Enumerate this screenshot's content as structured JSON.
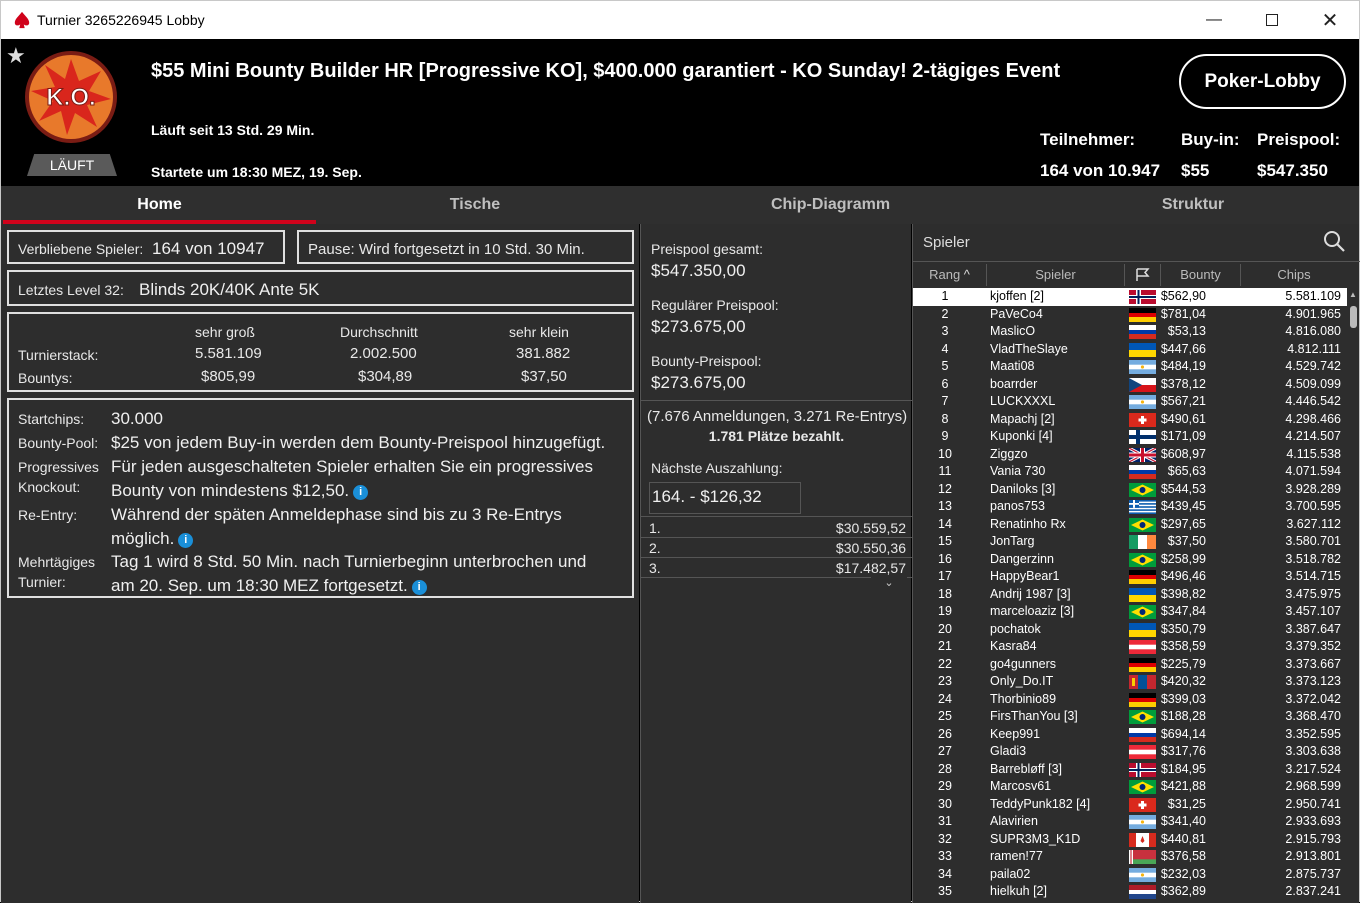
{
  "window": {
    "title": "Turnier 3265226945 Lobby"
  },
  "header": {
    "title": "$55 Mini Bounty Builder HR [Progressive KO], $400.000 garantiert - KO Sunday! 2-tägiges Event",
    "running": "Läuft seit 13 Std. 29 Min.",
    "started": "Startete um 18:30 MEZ, 19. Sep.",
    "status_badge": "LÄUFT",
    "logo_text": "K.O.",
    "lobby_button": "Poker-Lobby",
    "participants_label": "Teilnehmer:",
    "participants_value": "164 von 10.947",
    "buyin_label": "Buy-in:",
    "buyin_value": "$55",
    "prizepool_label": "Preispool:",
    "prizepool_value": "$547.350"
  },
  "tabs": [
    {
      "label": "Home",
      "active": true
    },
    {
      "label": "Tische"
    },
    {
      "label": "Chip-Diagramm"
    },
    {
      "label": "Struktur"
    }
  ],
  "home": {
    "remaining_label": "Verbliebene Spieler:",
    "remaining_value": "164 von 10947",
    "pause": "Pause: Wird fortgesetzt in 10 Std. 30 Min.",
    "level_label": "Letztes Level 32:",
    "level_value": "Blinds 20K/40K Ante 5K",
    "stats": {
      "cols": [
        "sehr groß",
        "Durchschnitt",
        "sehr klein"
      ],
      "stack_label": "Turnierstack:",
      "stack": [
        "5.581.109",
        "2.002.500",
        "381.882"
      ],
      "bounty_label": "Bountys:",
      "bounty": [
        "$805,99",
        "$304,89",
        "$37,50"
      ]
    },
    "info": {
      "startchips_label": "Startchips:",
      "startchips_value": "30.000",
      "bountypool_label": "Bounty-Pool:",
      "bountypool_value": "$25 von jedem Buy-in werden dem Bounty-Preispool hinzugefügt.",
      "pko_label1": "Progressives",
      "pko_label2": "Knockout:",
      "pko_value1": "Für jeden ausgeschalteten Spieler erhalten Sie ein progressives",
      "pko_value2": "Bounty von mindestens $12,50.",
      "reentry_label": "Re-Entry:",
      "reentry_value1": "Während der späten Anmeldephase sind bis zu 3 Re-Entrys",
      "reentry_value2": "möglich.",
      "multiday_label1": "Mehrtägiges",
      "multiday_label2": "Turnier:",
      "multiday_value1": "Tag 1 wird 8 Std. 50 Min. nach Turnierbeginn unterbrochen und",
      "multiday_value2": "am 20. Sep. um 18:30 MEZ fortgesetzt.",
      "info_glyph": "i"
    }
  },
  "prizes": {
    "total_label": "Preispool gesamt:",
    "total_value": "$547.350,00",
    "regular_label": "Regulärer Preispool:",
    "regular_value": "$273.675,00",
    "bounty_label": "Bounty-Preispool:",
    "bounty_value": "$273.675,00",
    "entries": "(7.676 Anmeldungen, 3.271 Re-Entrys)",
    "paid": "1.781 Plätze bezahlt.",
    "next_label": "Nächste Auszahlung:",
    "next_value": "164. - $126,32",
    "payouts": [
      {
        "place": "1.",
        "amount": "$30.559,52"
      },
      {
        "place": "2.",
        "amount": "$30.550,36"
      },
      {
        "place": "3.",
        "amount": "$17.482,57"
      }
    ]
  },
  "players": {
    "title": "Spieler",
    "columns": {
      "rank": "Rang",
      "player": "Spieler",
      "bounty": "Bounty",
      "chips": "Chips"
    },
    "rows": [
      {
        "rank": "1",
        "name": "kjoffen [2]",
        "flag": "NO",
        "bounty": "$562,90",
        "chips": "5.581.109"
      },
      {
        "rank": "2",
        "name": "PaVeCo4",
        "flag": "DE",
        "bounty": "$781,04",
        "chips": "4.901.965"
      },
      {
        "rank": "3",
        "name": "MaslicO",
        "flag": "RU",
        "bounty": "$53,13",
        "chips": "4.816.080"
      },
      {
        "rank": "4",
        "name": "VladTheSlaye",
        "flag": "UA",
        "bounty": "$447,66",
        "chips": "4.812.111"
      },
      {
        "rank": "5",
        "name": "Maati08",
        "flag": "AR",
        "bounty": "$484,19",
        "chips": "4.529.742"
      },
      {
        "rank": "6",
        "name": "boarrder",
        "flag": "CZ",
        "bounty": "$378,12",
        "chips": "4.509.099"
      },
      {
        "rank": "7",
        "name": "LUCKXXXL",
        "flag": "AR",
        "bounty": "$567,21",
        "chips": "4.446.542"
      },
      {
        "rank": "8",
        "name": "Mapachj [2]",
        "flag": "CH",
        "bounty": "$490,61",
        "chips": "4.298.466"
      },
      {
        "rank": "9",
        "name": "Kuponki [4]",
        "flag": "FI",
        "bounty": "$171,09",
        "chips": "4.214.507"
      },
      {
        "rank": "10",
        "name": "Ziggzo",
        "flag": "GB",
        "bounty": "$608,97",
        "chips": "4.115.538"
      },
      {
        "rank": "11",
        "name": "Vania 730",
        "flag": "RU",
        "bounty": "$65,63",
        "chips": "4.071.594"
      },
      {
        "rank": "12",
        "name": "Daniloks [3]",
        "flag": "BR",
        "bounty": "$544,53",
        "chips": "3.928.289"
      },
      {
        "rank": "13",
        "name": "panos753",
        "flag": "GR",
        "bounty": "$439,45",
        "chips": "3.700.595"
      },
      {
        "rank": "14",
        "name": "Renatinho Rx",
        "flag": "BR",
        "bounty": "$297,65",
        "chips": "3.627.112"
      },
      {
        "rank": "15",
        "name": "JonTarg",
        "flag": "IE",
        "bounty": "$37,50",
        "chips": "3.580.701"
      },
      {
        "rank": "16",
        "name": "Dangerzinn",
        "flag": "BR",
        "bounty": "$258,99",
        "chips": "3.518.782"
      },
      {
        "rank": "17",
        "name": "HappyBear1",
        "flag": "DE",
        "bounty": "$496,46",
        "chips": "3.514.715"
      },
      {
        "rank": "18",
        "name": "Andrij 1987 [3]",
        "flag": "UA",
        "bounty": "$398,82",
        "chips": "3.475.975"
      },
      {
        "rank": "19",
        "name": "marceloaziz [3]",
        "flag": "BR",
        "bounty": "$347,84",
        "chips": "3.457.107"
      },
      {
        "rank": "20",
        "name": "pochatok",
        "flag": "UA",
        "bounty": "$350,79",
        "chips": "3.387.647"
      },
      {
        "rank": "21",
        "name": "Kasra84",
        "flag": "AT",
        "bounty": "$358,59",
        "chips": "3.379.352"
      },
      {
        "rank": "22",
        "name": "go4gunners",
        "flag": "DE",
        "bounty": "$225,79",
        "chips": "3.373.667"
      },
      {
        "rank": "23",
        "name": "Only_Do.IT",
        "flag": "MN",
        "bounty": "$420,32",
        "chips": "3.373.123"
      },
      {
        "rank": "24",
        "name": "Thorbinio89",
        "flag": "DE",
        "bounty": "$399,03",
        "chips": "3.372.042"
      },
      {
        "rank": "25",
        "name": "FirsThanYou [3]",
        "flag": "BR",
        "bounty": "$188,28",
        "chips": "3.368.470"
      },
      {
        "rank": "26",
        "name": "Keep991",
        "flag": "RU",
        "bounty": "$694,14",
        "chips": "3.352.595"
      },
      {
        "rank": "27",
        "name": "Gladi3",
        "flag": "AT",
        "bounty": "$317,76",
        "chips": "3.303.638"
      },
      {
        "rank": "28",
        "name": "Barrebløff [3]",
        "flag": "NO",
        "bounty": "$184,95",
        "chips": "3.217.524"
      },
      {
        "rank": "29",
        "name": "Marcosv61",
        "flag": "BR",
        "bounty": "$421,88",
        "chips": "2.968.599"
      },
      {
        "rank": "30",
        "name": "TeddyPunk182 [4]",
        "flag": "CH",
        "bounty": "$31,25",
        "chips": "2.950.741"
      },
      {
        "rank": "31",
        "name": "Alavirien",
        "flag": "AR",
        "bounty": "$341,40",
        "chips": "2.933.693"
      },
      {
        "rank": "32",
        "name": "SUPR3M3_K1D",
        "flag": "CA",
        "bounty": "$440,81",
        "chips": "2.915.793"
      },
      {
        "rank": "33",
        "name": "ramen!77",
        "flag": "BY",
        "bounty": "$376,58",
        "chips": "2.913.801"
      },
      {
        "rank": "34",
        "name": "paila02",
        "flag": "AR",
        "bounty": "$232,03",
        "chips": "2.875.737"
      },
      {
        "rank": "35",
        "name": "hielkuh [2]",
        "flag": "NL",
        "bounty": "$362,89",
        "chips": "2.837.241"
      }
    ]
  }
}
